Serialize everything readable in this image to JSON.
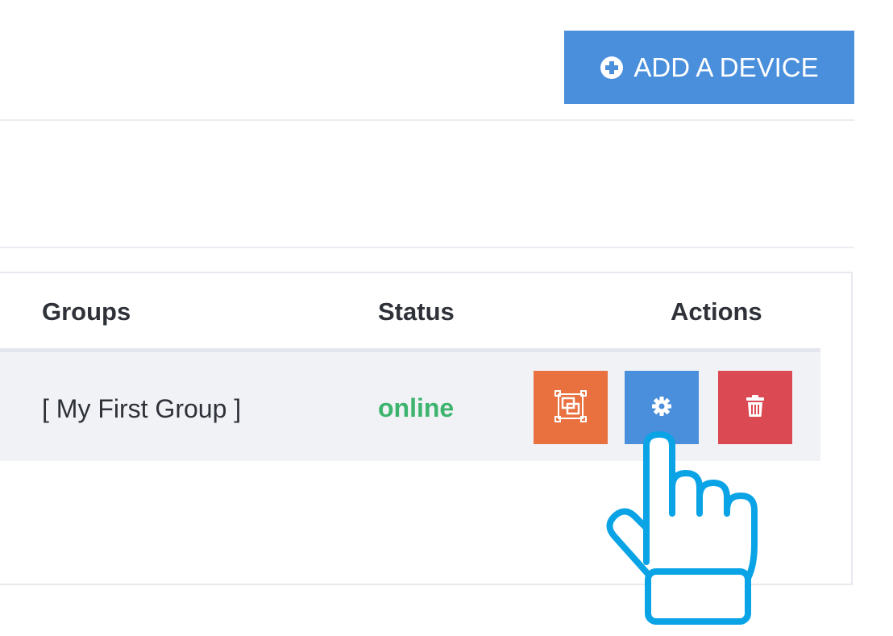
{
  "toolbar": {
    "add_device_label": "ADD A DEVICE",
    "add_icon": "plus-circle-icon",
    "accent_color": "#4a8fdb"
  },
  "table": {
    "columns": {
      "groups": "Groups",
      "status": "Status",
      "actions": "Actions"
    },
    "rows": [
      {
        "group": "[ My First Group ]",
        "status": "online",
        "status_color": "#3db46d",
        "actions": [
          {
            "name": "screen-icon",
            "color": "#e8713f"
          },
          {
            "name": "gear-icon",
            "color": "#4a8fdb"
          },
          {
            "name": "trash-icon",
            "color": "#db4a52"
          }
        ]
      }
    ]
  },
  "overlay": {
    "pointer_icon": "hand-pointer-icon",
    "pointer_color": "#0aa3e6"
  }
}
